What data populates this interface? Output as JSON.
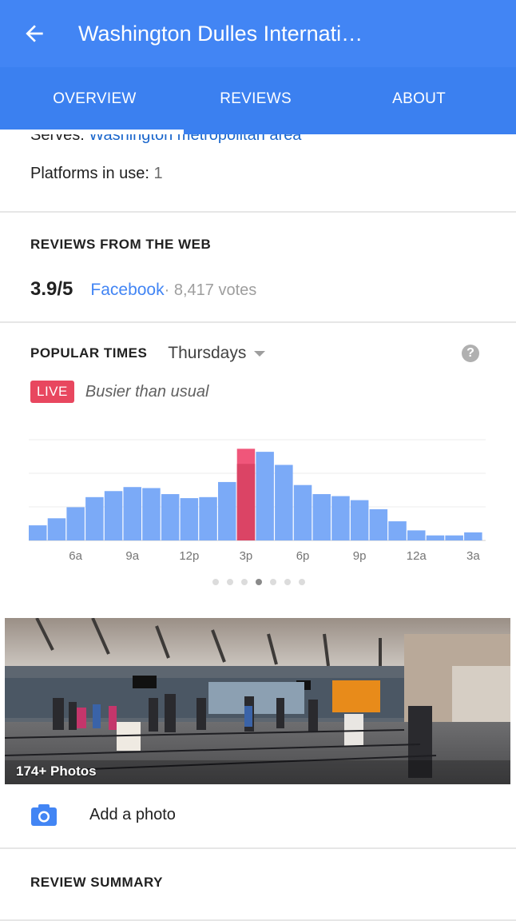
{
  "header": {
    "title": "Washington Dulles Internati…",
    "back_icon": "arrow-back-icon"
  },
  "tabs": [
    {
      "label": "OVERVIEW",
      "selected": true
    },
    {
      "label": "REVIEWS",
      "selected": false
    },
    {
      "label": "ABOUT",
      "selected": false
    }
  ],
  "info": {
    "serves_label": "Serves: ",
    "serves_value": "Washington metropolitan area",
    "platforms_label": "Platforms in use: ",
    "platforms_value": "1"
  },
  "reviews_web": {
    "title": "REVIEWS FROM THE WEB",
    "rating": "3.9/5",
    "source": "Facebook",
    "votes": " · 8,417 votes"
  },
  "popular_times": {
    "title": "POPULAR TIMES",
    "day": "Thursdays",
    "help_icon": "help-icon",
    "live_badge": "LIVE",
    "live_text": "Busier than usual",
    "colors": {
      "bar": "#7baaf7",
      "current": "#db4465",
      "live": "#f0567a"
    }
  },
  "chart_data": {
    "type": "bar",
    "categories": [
      "4a",
      "5a",
      "6a",
      "7a",
      "8a",
      "9a",
      "10a",
      "11a",
      "12p",
      "1p",
      "2p",
      "3p",
      "4p",
      "5p",
      "6p",
      "7p",
      "8p",
      "9p",
      "10p",
      "11p",
      "12a",
      "1a",
      "2a",
      "3a",
      "4a"
    ],
    "x_tick_labels": [
      "6a",
      "9a",
      "12p",
      "3p",
      "6p",
      "9p",
      "12a",
      "3a"
    ],
    "series": [
      {
        "values": [
          15,
          22,
          33,
          43,
          49,
          53,
          52,
          46,
          42,
          43,
          58,
          76,
          88,
          75,
          55,
          46,
          44,
          40,
          31,
          19,
          10,
          5,
          5,
          8,
          0
        ]
      }
    ],
    "current_index": 11,
    "live_value": 91,
    "ylim": [
      0,
      100
    ],
    "grid": true
  },
  "carousel": {
    "count": 7,
    "active": 3
  },
  "photos": {
    "count_label": "174+ Photos"
  },
  "add_photo": {
    "label": "Add a photo",
    "icon": "camera-icon"
  },
  "review_summary": {
    "title": "REVIEW SUMMARY"
  }
}
